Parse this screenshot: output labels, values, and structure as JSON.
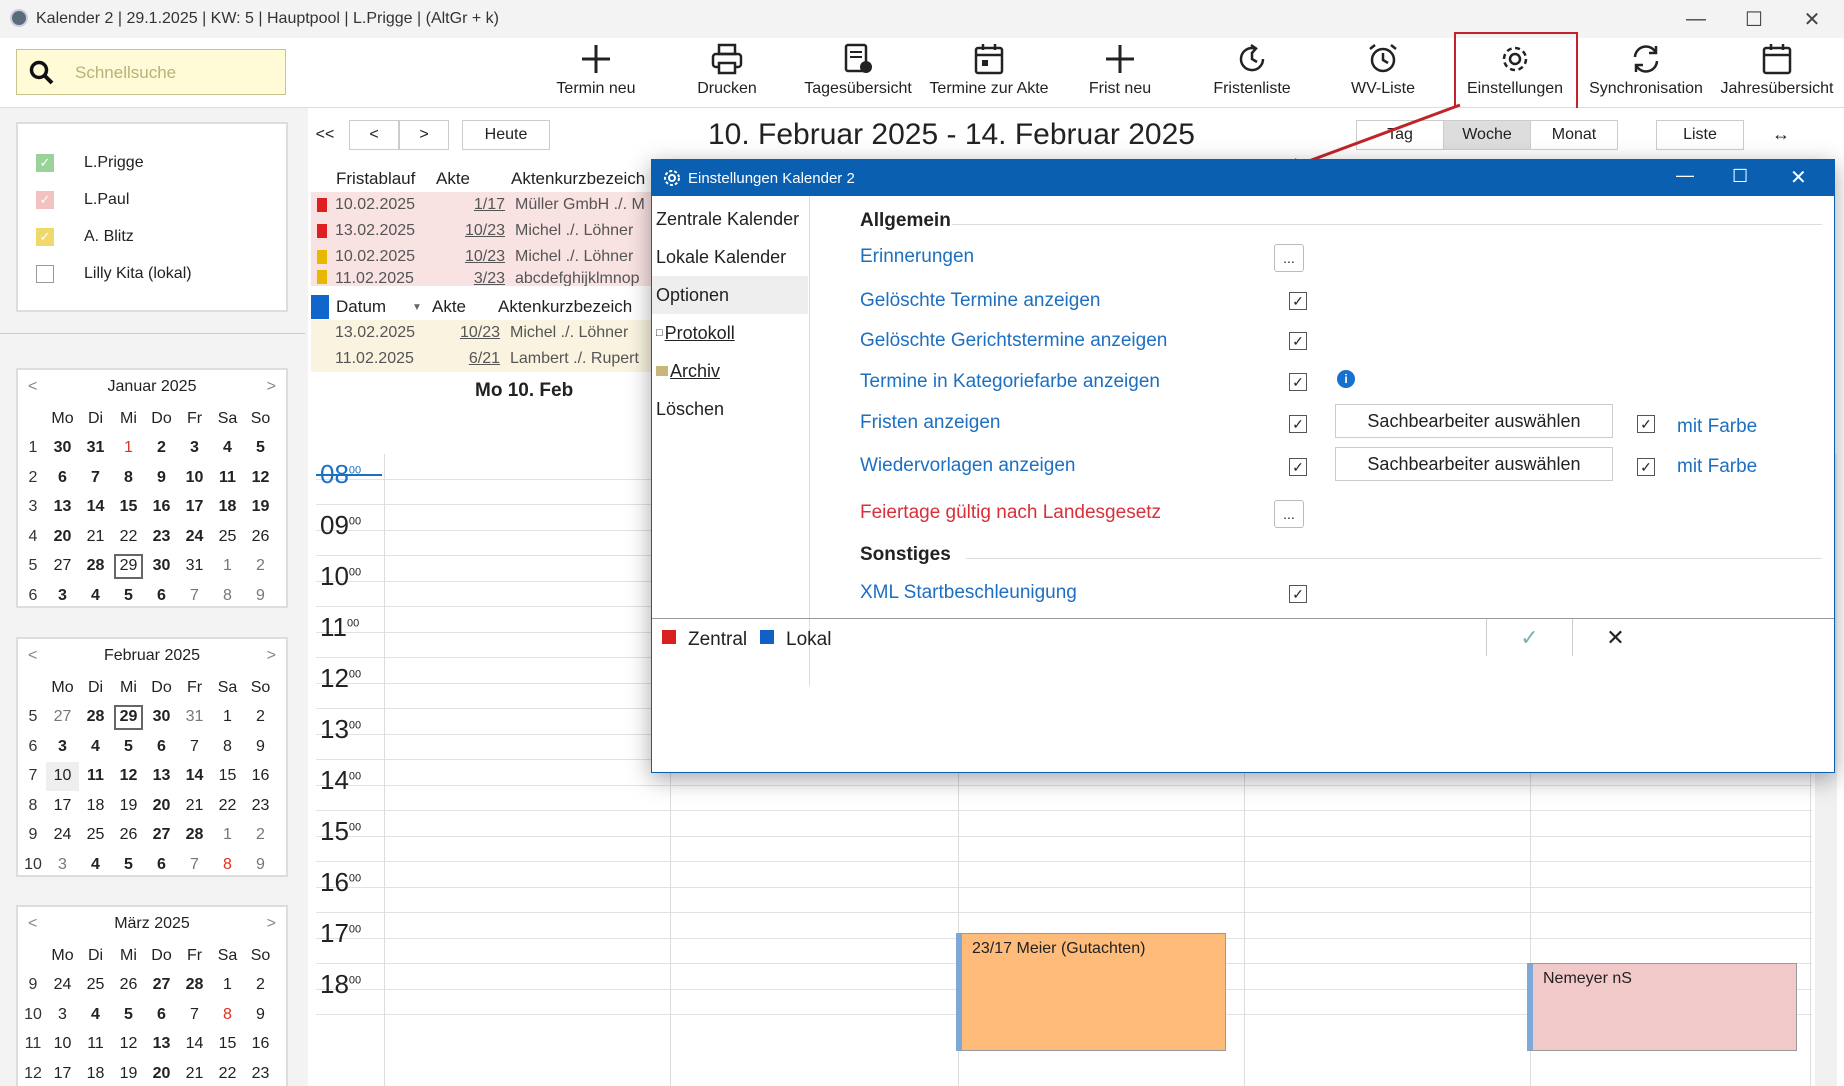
{
  "window": {
    "title": "Kalender 2 | 29.1.2025 | KW: 5 | Hauptpool | L.Prigge | (AltGr + k)"
  },
  "search": {
    "placeholder": "Schnellsuche"
  },
  "toolbar": {
    "termin_neu": "Termin neu",
    "drucken": "Drucken",
    "tagesuebersicht": "Tagesübersicht",
    "termine_akte": "Termine zur Akte",
    "frist_neu": "Frist neu",
    "fristenliste": "Fristenliste",
    "wv_liste": "WV-Liste",
    "einstellungen": "Einstellungen",
    "synchronisation": "Synchronisation",
    "jahresuebersicht": "Jahresübersicht"
  },
  "calendars": [
    {
      "label": "L.Prigge",
      "checked": true,
      "color": "#8fd18f"
    },
    {
      "label": "L.Paul",
      "checked": true,
      "color": "#f2b8b8"
    },
    {
      "label": "A. Blitz",
      "checked": true,
      "color": "#f2dc6a"
    },
    {
      "label": "Lilly Kita (lokal)",
      "checked": false,
      "color": "#ffffff"
    }
  ],
  "minical": {
    "weekdays": [
      "Mo",
      "Di",
      "Mi",
      "Do",
      "Fr",
      "Sa",
      "So"
    ],
    "januar": {
      "title": "Januar 2025"
    },
    "februar": {
      "title": "Februar 2025"
    },
    "maerz": {
      "title": "März 2025"
    }
  },
  "nav": {
    "first": "<<",
    "prev": "<",
    "next": ">",
    "today": "Heute"
  },
  "week_title": "10. Februar 2025 - 14. Februar 2025",
  "views": {
    "tag": "Tag",
    "woche": "Woche",
    "monat": "Monat",
    "liste": "Liste"
  },
  "fristen": {
    "headers": {
      "fristablauf": "Fristablauf",
      "akte": "Akte",
      "kurz": "Aktenkurzbezeich"
    },
    "rows": [
      {
        "date": "10.02.2025",
        "akte": "1/17",
        "kurz": "Müller GmbH ./. M",
        "flag": "#e02020"
      },
      {
        "date": "13.02.2025",
        "akte": "10/23",
        "kurz": "Michel ./. Löhner",
        "flag": "#e02020"
      },
      {
        "date": "10.02.2025",
        "akte": "10/23",
        "kurz": "Michel ./. Löhner",
        "flag": "#e8b800"
      },
      {
        "date": "11.02.2025",
        "akte": "3/23",
        "kurz": "abcdefghijklmnop",
        "flag": "#e8b800"
      }
    ]
  },
  "wv": {
    "headers": {
      "datum": "Datum",
      "akte": "Akte",
      "kurz": "Aktenkurzbezeich"
    },
    "rows": [
      {
        "date": "13.02.2025",
        "akte": "10/23",
        "kurz": "Michel ./. Löhner"
      },
      {
        "date": "11.02.2025",
        "akte": "6/21",
        "kurz": "Lambert ./. Rupert"
      }
    ]
  },
  "day_header": "Mo 10. Feb",
  "hours": [
    "08",
    "09",
    "10",
    "11",
    "12",
    "13",
    "14",
    "15",
    "16",
    "17",
    "18"
  ],
  "hour_sup": "00",
  "events": [
    {
      "title": "23/17 Meier (Gutachten)",
      "color": "#ffbb7a"
    },
    {
      "title": "Nemeyer nS",
      "color": "#f2c9c9"
    }
  ],
  "dialog": {
    "title": "Einstellungen Kalender 2",
    "nav": [
      "Zentrale Kalender",
      "Lokale Kalender",
      "Optionen",
      "Protokoll",
      "Archiv",
      "Löschen"
    ],
    "section_allgemein": "Allgemein",
    "section_sonstiges": "Sonstiges",
    "erinnerungen": "Erinnerungen",
    "geloeschte_termine": "Gelöschte Termine anzeigen",
    "geloeschte_gericht": "Gelöschte Gerichtstermine anzeigen",
    "kategoriefarbe": "Termine in Kategoriefarbe anzeigen",
    "fristen_anzeigen": "Fristen anzeigen",
    "wiedervorlagen": "Wiedervorlagen anzeigen",
    "feiertage": "Feiertage gültig nach Landesgesetz",
    "xml": "XML Startbeschleunigung",
    "sachbearbeiter": "Sachbearbeiter auswählen",
    "mit_farbe": "mit Farbe",
    "dots": "...",
    "legend_zentral": "Zentral",
    "legend_lokal": "Lokal"
  }
}
